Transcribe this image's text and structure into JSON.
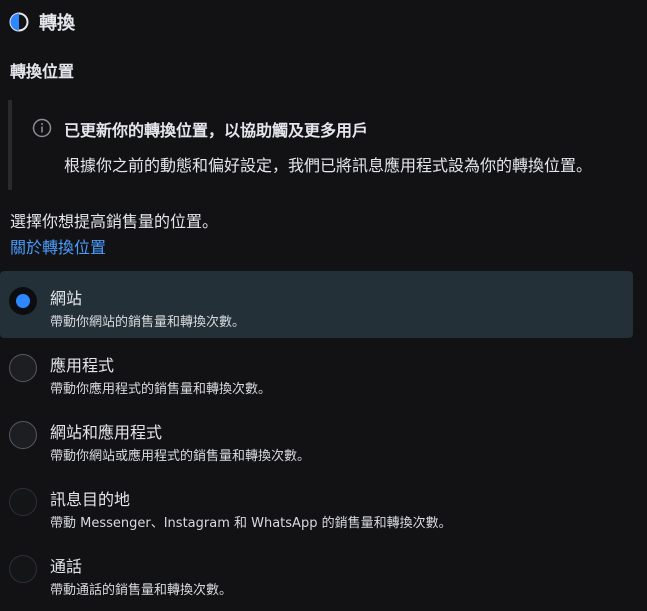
{
  "header": {
    "title": "轉換",
    "icon": "contrast-half-circle-icon"
  },
  "section": {
    "title": "轉換位置"
  },
  "notice": {
    "icon": "info-circle-icon",
    "title": "已更新你的轉換位置，以協助觸及更多用戶",
    "body": "根據你之前的動態和偏好設定，我們已將訊息應用程式設為你的轉換位置。"
  },
  "prompt": {
    "text": "選擇你想提高銷售量的位置。",
    "link": "關於轉換位置"
  },
  "options": [
    {
      "label": "網站",
      "description": "帶動你網站的銷售量和轉換次數。",
      "selected": true
    },
    {
      "label": "應用程式",
      "description": "帶動你應用程式的銷售量和轉換次數。",
      "selected": false
    },
    {
      "label": "網站和應用程式",
      "description": "帶動你網站或應用程式的銷售量和轉換次數。",
      "selected": false
    },
    {
      "label": "訊息目的地",
      "description": "帶動 Messenger、Instagram 和 WhatsApp 的銷售量和轉換次數。",
      "selected": false
    },
    {
      "label": "通話",
      "description": "帶動通話的銷售量和轉換次數。",
      "selected": false
    }
  ],
  "colors": {
    "accent": "#2d88ff",
    "link": "#4a9dff",
    "selected_bg": "#233038",
    "background": "#121214"
  }
}
